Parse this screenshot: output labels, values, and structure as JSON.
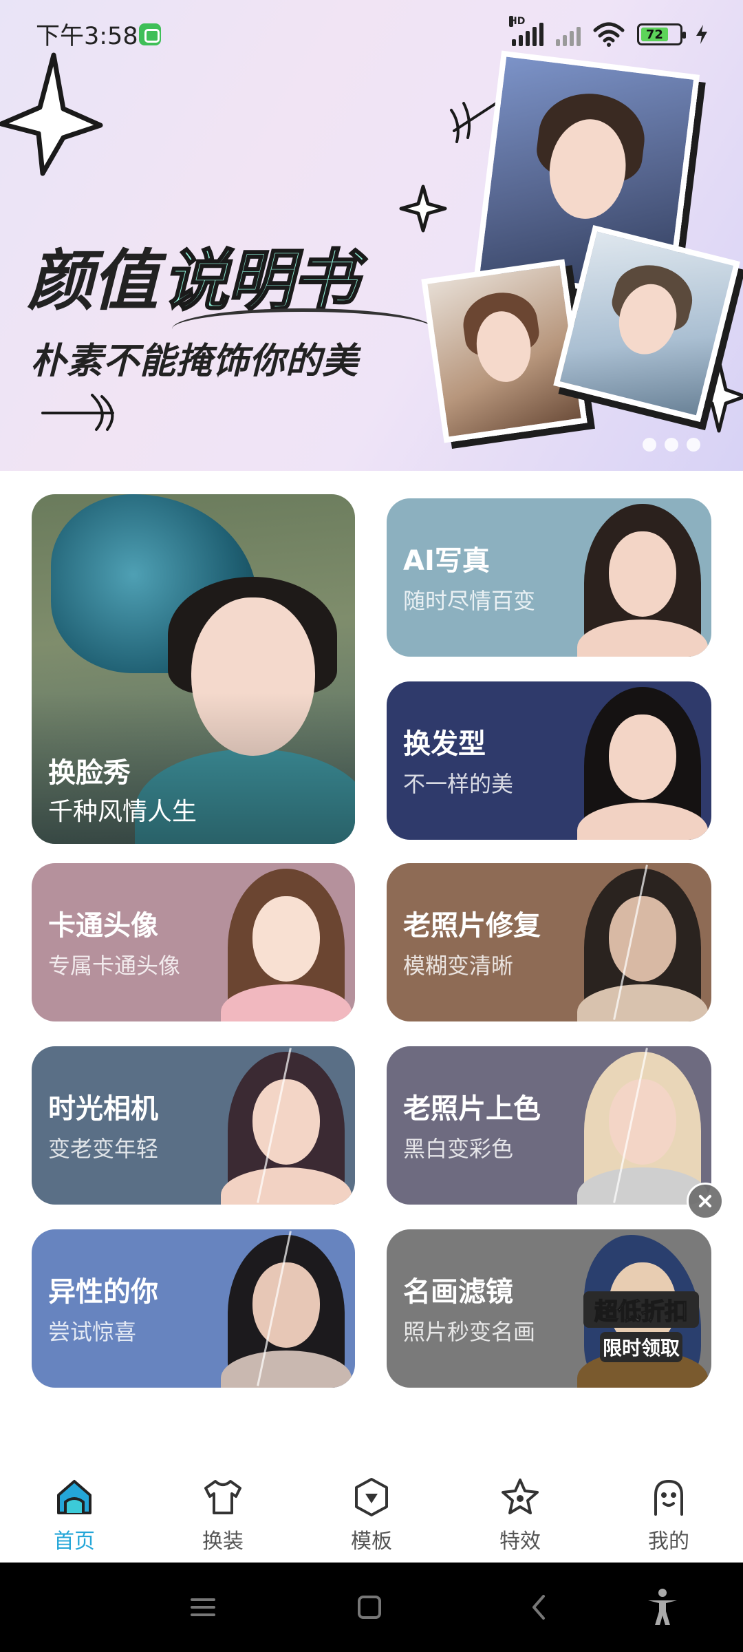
{
  "status_bar": {
    "time": "下午3:58",
    "signal_label": "HD",
    "battery": "72"
  },
  "banner": {
    "title_main": "颜值",
    "title_accent": "说明书",
    "subtitle": "朴素不能掩饰你的美",
    "page_count": 3
  },
  "features": [
    {
      "title": "换脸秀",
      "subtitle": "千种风情人生"
    },
    {
      "title": "AI写真",
      "subtitle": "随时尽情百变"
    },
    {
      "title": "换发型",
      "subtitle": "不一样的美"
    },
    {
      "title": "卡通头像",
      "subtitle": "专属卡通头像"
    },
    {
      "title": "老照片修复",
      "subtitle": "模糊变清晰"
    },
    {
      "title": "时光相机",
      "subtitle": "变老变年轻"
    },
    {
      "title": "老照片上色",
      "subtitle": "黑白变彩色"
    },
    {
      "title": "异性的你",
      "subtitle": "尝试惊喜"
    },
    {
      "title": "名画滤镜",
      "subtitle": "照片秒变名画"
    }
  ],
  "promo": {
    "main": "超低折扣",
    "sub": "限时领取"
  },
  "tabs": [
    {
      "label": "首页",
      "icon": "home-icon",
      "active": true
    },
    {
      "label": "换装",
      "icon": "shirt-icon",
      "active": false
    },
    {
      "label": "模板",
      "icon": "template-icon",
      "active": false
    },
    {
      "label": "特效",
      "icon": "star-icon",
      "active": false
    },
    {
      "label": "我的",
      "icon": "profile-icon",
      "active": false
    }
  ],
  "colors": {
    "accent": "#24a6d8",
    "ai_card": "#8cb0bf",
    "hair_card": "#2f3a6b",
    "cartoon_card": "#b5919c",
    "restore_card": "#8e6b55",
    "time_card": "#5a6f86",
    "colorize_card": "#6e6b80",
    "gender_card": "#6784bf",
    "painting_card": "#7a7a7a"
  }
}
